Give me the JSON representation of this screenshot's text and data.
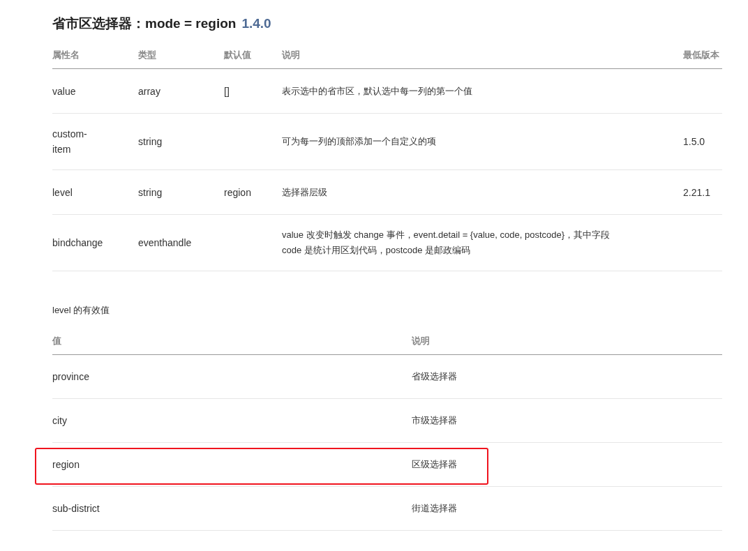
{
  "title": {
    "text": "省市区选择器：mode = region",
    "version": "1.4.0"
  },
  "attributes_table": {
    "columns": [
      "属性名",
      "类型",
      "默认值",
      "说明",
      "最低版本"
    ],
    "rows": [
      {
        "cells": [
          "value",
          "array",
          "[]",
          "表示选中的省市区，默认选中每一列的第一个值",
          ""
        ]
      },
      {
        "cells": [
          "custom-item",
          "string",
          "",
          "可为每一列的顶部添加一个自定义的项",
          "1.5.0"
        ]
      },
      {
        "cells": [
          "level",
          "string",
          "region",
          "选择器层级",
          "2.21.1"
        ]
      },
      {
        "cells": [
          "bindchange",
          "eventhandle",
          "",
          "value 改变时触发 change 事件，event.detail = {value, code, postcode}，其中字段 code 是统计用区划代码，postcode 是邮政编码",
          ""
        ]
      }
    ]
  },
  "level_section": {
    "caption": "level 的有效值",
    "columns": [
      "值",
      "说明"
    ],
    "rows": [
      {
        "cells": [
          "province",
          "省级选择器"
        ],
        "highlighted": false
      },
      {
        "cells": [
          "city",
          "市级选择器"
        ],
        "highlighted": false
      },
      {
        "cells": [
          "region",
          "区级选择器"
        ],
        "highlighted": true
      },
      {
        "cells": [
          "sub-district",
          "街道选择器"
        ],
        "highlighted": false
      }
    ]
  }
}
